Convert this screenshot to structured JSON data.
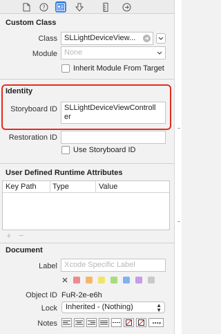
{
  "custom_class": {
    "title": "Custom Class",
    "class_label": "Class",
    "class_value": "SLLightDeviceView...",
    "module_label": "Module",
    "module_placeholder": "None",
    "inherit_label": "Inherit Module From Target"
  },
  "identity": {
    "title": "Identity",
    "storyboard_id_label": "Storyboard ID",
    "storyboard_id_line1": "SLLightDeviceViewControll",
    "storyboard_id_line2": "er",
    "restoration_id_label": "Restoration ID",
    "restoration_id_value": "",
    "use_storyboard_id_label": "Use Storyboard ID"
  },
  "runtime_attributes": {
    "title": "User Defined Runtime Attributes",
    "columns": [
      "Key Path",
      "Type",
      "Value"
    ],
    "add_symbol": "+",
    "remove_symbol": "−"
  },
  "document": {
    "title": "Document",
    "label_label": "Label",
    "label_placeholder": "Xcode Specific Label",
    "object_id_label": "Object ID",
    "object_id_value": "FuR-2e-e6h",
    "lock_label": "Lock",
    "lock_value": "Inherited - (Nothing)",
    "notes_label": "Notes",
    "swatch_colors": [
      "#f08a8a",
      "#f5b66b",
      "#f2e36b",
      "#a6dd7a",
      "#7fb3f0",
      "#c69be8",
      "#c9c9c9"
    ]
  },
  "colors": {
    "accent": "#3b80e6",
    "highlight": "#e62b1e"
  }
}
